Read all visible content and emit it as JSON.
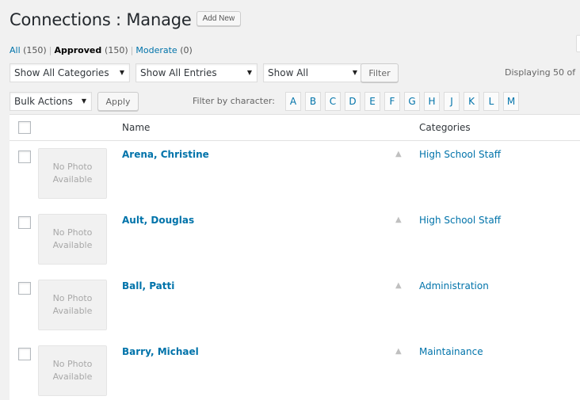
{
  "header": {
    "title": "Connections : Manage",
    "add_new_label": "Add New"
  },
  "status_links": [
    {
      "label": "All",
      "count": "(150)",
      "current": false
    },
    {
      "label": "Approved",
      "count": "(150)",
      "current": true
    },
    {
      "label": "Moderate",
      "count": "(0)",
      "current": false
    }
  ],
  "filters": {
    "category_select": "Show All Categories",
    "entries_select": "Show All Entries",
    "visibility_select": "Show All",
    "filter_button": "Filter",
    "displaying_text": "Displaying 50 of"
  },
  "bulk": {
    "actions_select": "Bulk Actions",
    "apply_button": "Apply",
    "filter_by_char_label": "Filter by character:",
    "letters": [
      "A",
      "B",
      "C",
      "D",
      "E",
      "F",
      "G",
      "H",
      "J",
      "K",
      "L",
      "M"
    ]
  },
  "table": {
    "col_name": "Name",
    "col_categories": "Categories",
    "no_photo_line1": "No Photo",
    "no_photo_line2": "Available",
    "rows": [
      {
        "name": "Arena, Christine",
        "category": "High School Staff"
      },
      {
        "name": "Ault, Douglas",
        "category": "High School Staff"
      },
      {
        "name": "Ball, Patti",
        "category": "Administration"
      },
      {
        "name": "Barry, Michael",
        "category": "Maintainance"
      }
    ]
  },
  "colors": {
    "link": "#0073aa",
    "background": "#f1f1f1",
    "panel": "#ffffff"
  },
  "icons": {
    "select_arrow": "caret-down-icon",
    "row_marker": "triangle-up-icon"
  }
}
